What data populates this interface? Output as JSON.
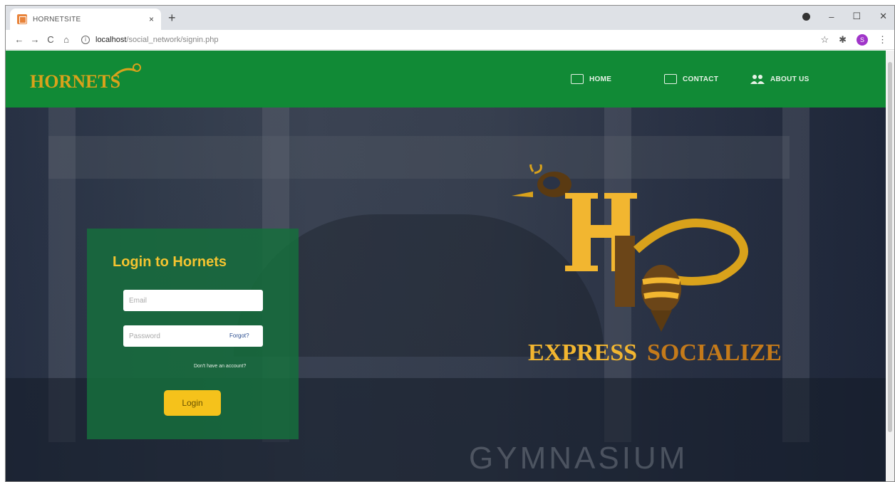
{
  "browser": {
    "tab_title": "HORNETSITE",
    "tab_close": "×",
    "new_tab": "+",
    "url_host": "localhost",
    "url_path": "/social_network/signin.php",
    "profile_initial": "S",
    "controls": {
      "minimize": "–",
      "maximize": "☐",
      "close": "✕"
    },
    "nav": {
      "back": "←",
      "forward": "→",
      "reload": "C",
      "home": "⌂"
    },
    "toolbar_icons": {
      "star": "☆",
      "extensions": "✱"
    }
  },
  "header": {
    "brand": "HORNETS",
    "nav": [
      {
        "label": "HOME",
        "icon": "home-icon"
      },
      {
        "label": "CONTACT",
        "icon": "mail-icon"
      },
      {
        "label": "ABOUT US",
        "icon": "group-icon"
      }
    ],
    "colors": {
      "navbar": "#118a36",
      "accent": "#f4c430"
    }
  },
  "login": {
    "title": "Login to Hornets",
    "email_placeholder": "Email",
    "password_placeholder": "Password",
    "forgot": "Forgot?",
    "signup_link": "Don't have an account?",
    "submit": "Login"
  },
  "hero": {
    "tagline_left": "EXPRESS",
    "tagline_right": "SOCIALIZE",
    "background_text": "GYMNASIUM"
  }
}
